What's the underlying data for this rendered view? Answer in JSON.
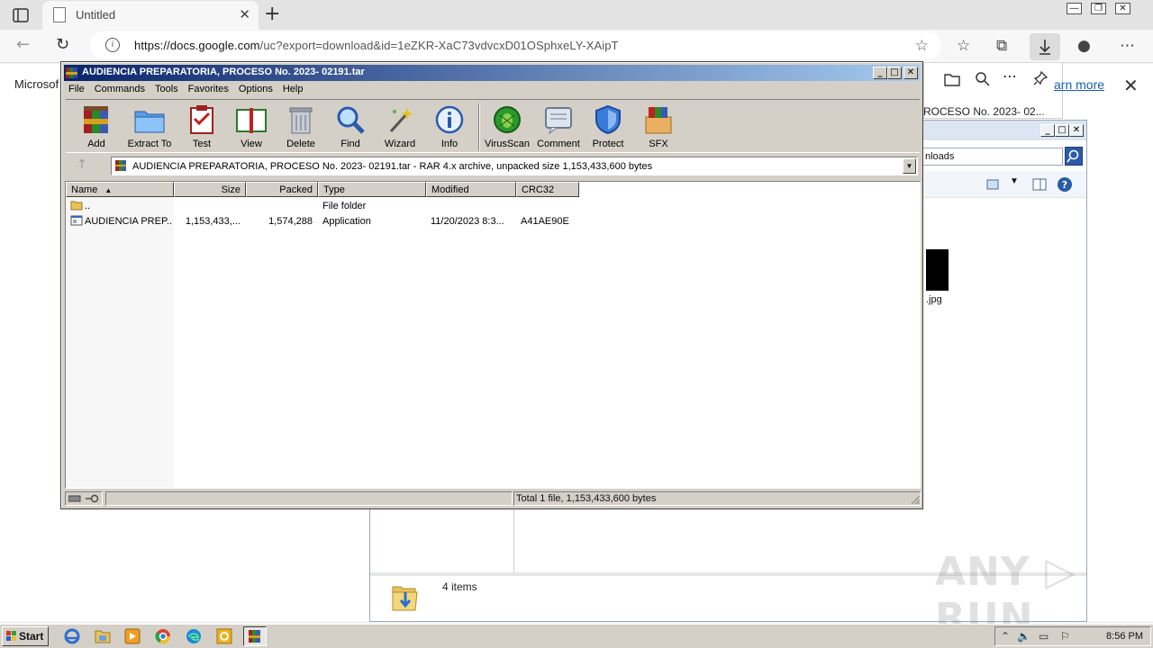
{
  "browser": {
    "tab_title": "Untitled",
    "tab_close": "✕",
    "new_tab": "+",
    "url_host": "https://docs.google.com",
    "url_path": "/uc?export=download&id=1eZKR-XaC73vdvcxD01OSphxeLY-XAipT",
    "page_left_text": "Microsof",
    "flyout_text": "ROCESO No. 2023- 02...",
    "learn_more": "arn more",
    "infobar_close": "✕"
  },
  "explorer": {
    "address_text": "nloads",
    "thumb_label": ".jpg",
    "status_items": "4 items"
  },
  "winrar": {
    "title": "AUDIENCIA PREPARATORIA, PROCESO No. 2023- 02191.tar",
    "menu": [
      "File",
      "Commands",
      "Tools",
      "Favorites",
      "Options",
      "Help"
    ],
    "toolbar": [
      "Add",
      "Extract To",
      "Test",
      "View",
      "Delete",
      "Find",
      "Wizard",
      "Info",
      "VirusScan",
      "Comment",
      "Protect",
      "SFX"
    ],
    "path_text": "AUDIENCIA PREPARATORIA, PROCESO No. 2023- 02191.tar - RAR 4.x archive, unpacked size 1,153,433,600 bytes",
    "columns": [
      "Name",
      "Size",
      "Packed",
      "Type",
      "Modified",
      "CRC32"
    ],
    "rows": [
      {
        "name": "..",
        "size": "",
        "packed": "",
        "type": "File folder",
        "modified": "",
        "crc": ""
      },
      {
        "name": "AUDIENCIA PREP...",
        "size": "1,153,433,...",
        "packed": "1,574,288",
        "type": "Application",
        "modified": "11/20/2023 8:3...",
        "crc": "A41AE90E"
      }
    ],
    "status_total": "Total 1 file, 1,153,433,600 bytes"
  },
  "watermark": "ANY ▷ RUN",
  "taskbar": {
    "start_label": "Start",
    "clock": "8:56 PM"
  }
}
